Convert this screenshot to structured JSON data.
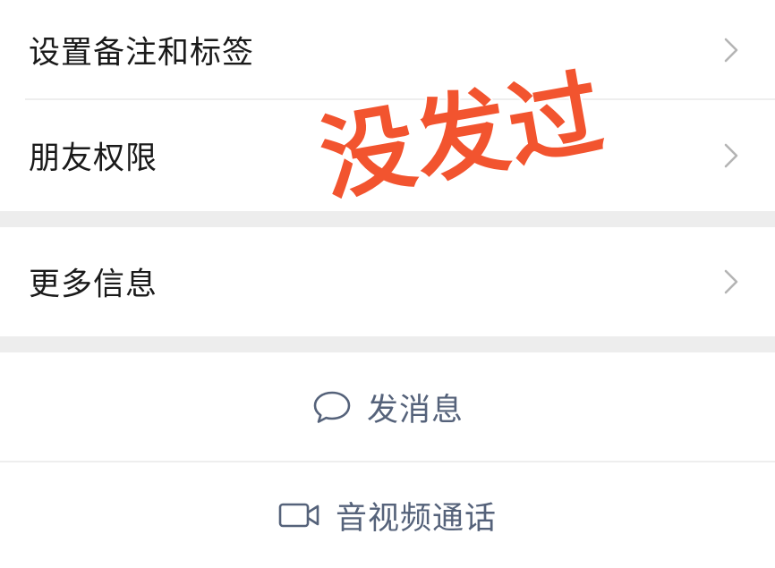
{
  "settings": {
    "items": [
      {
        "label": "设置备注和标签"
      },
      {
        "label": "朋友权限"
      },
      {
        "label": "更多信息"
      }
    ]
  },
  "actions": {
    "message_label": "发消息",
    "video_call_label": "音视频通话"
  },
  "overlay": {
    "stamp_text": "没发过"
  },
  "colors": {
    "stamp": "#f2542f",
    "action_text": "#55627a",
    "section_gap": "#ededed"
  },
  "icons": {
    "row_chevron": "chevron-right-icon",
    "message": "chat-bubble-icon",
    "video": "video-camera-icon"
  }
}
